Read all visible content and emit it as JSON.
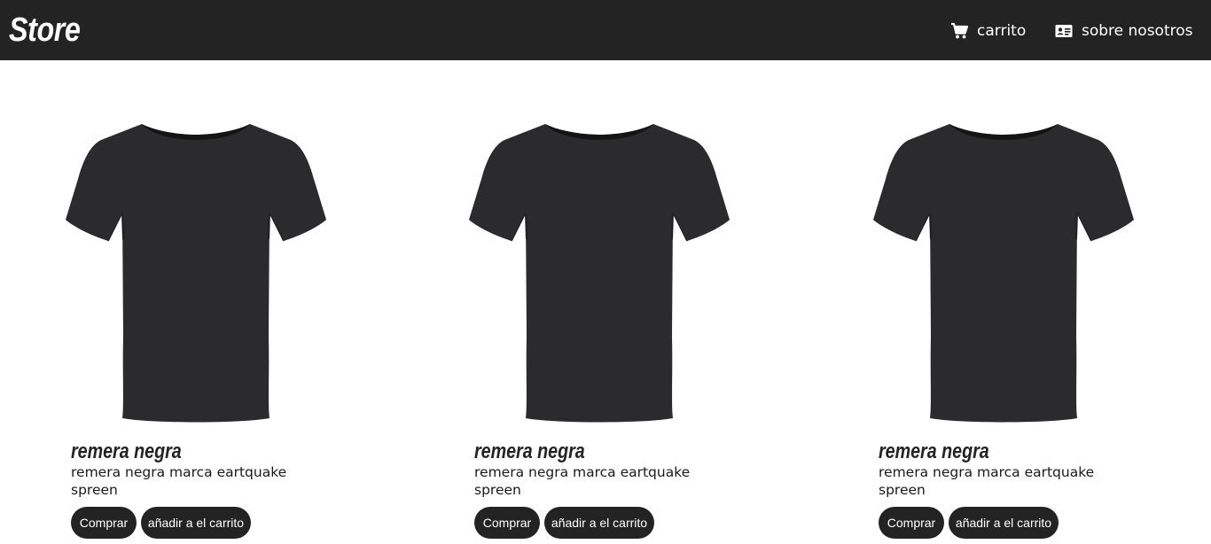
{
  "navbar": {
    "brand": "Store",
    "cart_label": "carrito",
    "cart_icon": "shopping-cart-icon",
    "about_label": "sobre nosotros",
    "about_icon": "id-card-icon",
    "background": "#232323"
  },
  "products": [
    {
      "title": "remera negra",
      "description": "remera negra marca eartquake spreen",
      "buy_label": "Comprar",
      "add_label": "añadir a el carrito"
    },
    {
      "title": "remera negra",
      "description": "remera negra marca eartquake spreen",
      "buy_label": "Comprar",
      "add_label": "añadir a el carrito"
    },
    {
      "title": "remera negra",
      "description": "remera negra marca eartquake spreen",
      "buy_label": "Comprar",
      "add_label": "añadir a el carrito"
    }
  ]
}
